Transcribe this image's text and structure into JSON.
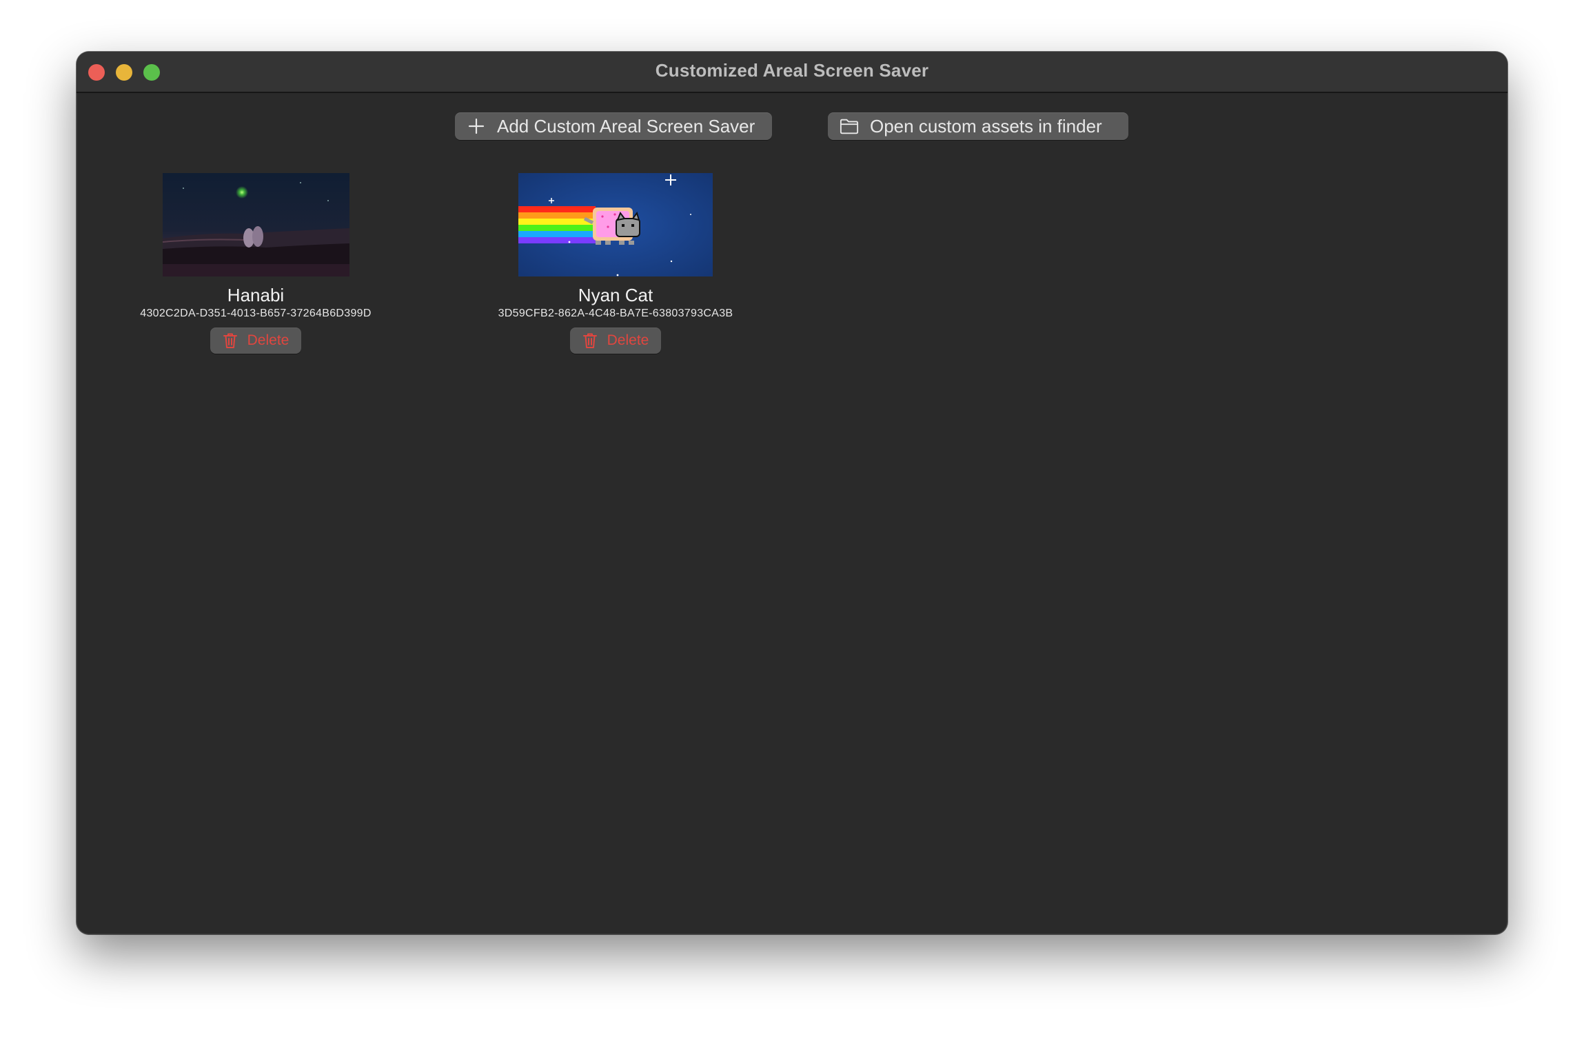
{
  "window": {
    "title": "Customized Areal Screen Saver"
  },
  "toolbar": {
    "add_label": "Add Custom Areal Screen Saver",
    "add_icon": "plus-icon",
    "open_label": "Open custom assets in finder",
    "open_icon": "folder-icon"
  },
  "savers": [
    {
      "name": "Hanabi",
      "id": "4302C2DA-D351-4013-B657-37264B6D399D",
      "delete_label": "Delete",
      "delete_icon": "trash-icon"
    },
    {
      "name": "Nyan Cat",
      "id": "3D59CFB2-862A-4C48-BA7E-63803793CA3B",
      "delete_label": "Delete",
      "delete_icon": "trash-icon"
    }
  ],
  "colors": {
    "window_bg": "#2a2a2a",
    "titlebar_bg": "#343434",
    "button_bg": "#5a5a5a",
    "delete_text": "#e0463f",
    "close": "#ec5f57",
    "minimize": "#e8b53a",
    "zoom": "#5bc04b"
  }
}
